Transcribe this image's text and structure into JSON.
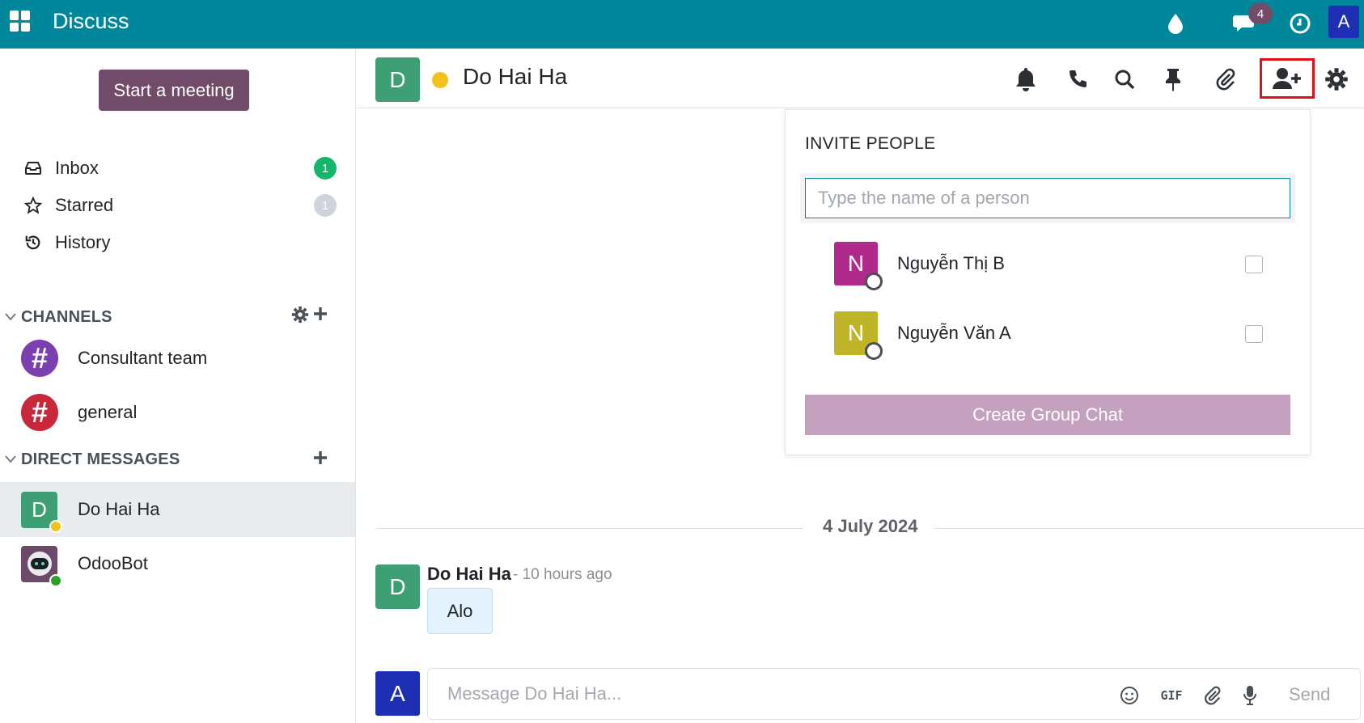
{
  "topbar": {
    "app_title": "Discuss",
    "messages_badge": "4",
    "user_initial": "A",
    "icons": [
      "apps-icon",
      "drop-icon",
      "chat-icon",
      "clock-icon"
    ]
  },
  "sidebar": {
    "start_meeting": "Start a meeting",
    "inbox": {
      "label": "Inbox",
      "count": "1"
    },
    "starred": {
      "label": "Starred",
      "count": "1"
    },
    "history": {
      "label": "History"
    },
    "channels_header": "CHANNELS",
    "channels": [
      {
        "name": "Consultant team",
        "color": "#7b3fb0"
      },
      {
        "name": "general",
        "color": "#c8283a"
      }
    ],
    "dm_header": "DIRECT MESSAGES",
    "direct_messages": [
      {
        "name": "Do Hai Ha",
        "initial": "D",
        "color": "#3f9f74",
        "status_color": "#f3c11b"
      },
      {
        "name": "OdooBot",
        "status_color": "#2ba32b"
      }
    ]
  },
  "thread": {
    "avatar_initial": "D",
    "name": "Do Hai Ha"
  },
  "invite": {
    "title": "INVITE PEOPLE",
    "placeholder": "Type the name of a person",
    "people": [
      {
        "initial": "N",
        "name": "Nguyễn Thị B",
        "color": "#b02a8c"
      },
      {
        "initial": "N",
        "name": "Nguyễn Văn A",
        "color": "#c0b428"
      }
    ],
    "create_button": "Create Group Chat"
  },
  "messages": {
    "date": "4 July 2024",
    "items": [
      {
        "initial": "D",
        "author": "Do Hai Ha",
        "time": "- 10 hours ago",
        "text": "Alo"
      }
    ]
  },
  "composer": {
    "avatar_initial": "A",
    "placeholder": "Message Do Hai Ha...",
    "gif_label": "GIF",
    "send_label": "Send"
  }
}
